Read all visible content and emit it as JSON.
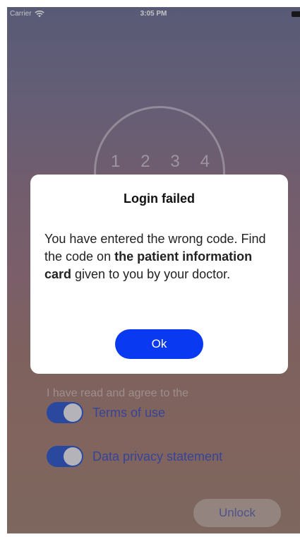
{
  "status_bar": {
    "carrier": "Carrier",
    "time": "3:05 PM",
    "wifi_icon": "wifi-icon",
    "battery_icon": "battery-icon"
  },
  "background": {
    "code_digits": [
      "1",
      "2",
      "3",
      "4"
    ],
    "consent_text": "I have read and agree to the",
    "toggles": [
      {
        "label": "Terms of use",
        "on": true
      },
      {
        "label": "Data privacy statement",
        "on": true
      }
    ],
    "unlock_label": "Unlock"
  },
  "dialog": {
    "title": "Login failed",
    "message_part1": "You have entered the wrong code. Find the code on ",
    "message_bold": "the patient information card",
    "message_part2": " given to you by your doctor.",
    "ok_label": "Ok"
  },
  "colors": {
    "accent": "#0a39f2",
    "toggle_on": "#2a55c8"
  }
}
